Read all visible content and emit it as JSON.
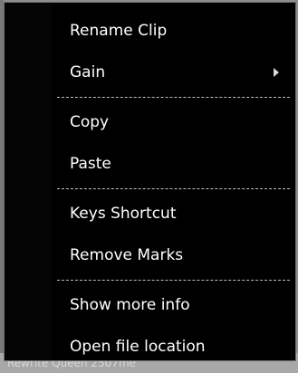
{
  "background": {
    "footer_text": "Rewrite Queen 2507me"
  },
  "menu": {
    "items": [
      {
        "label": "Rename Clip"
      },
      {
        "label": "Gain",
        "has_submenu": true,
        "submenu_icon": "triangle-right-icon"
      },
      {
        "separator": true
      },
      {
        "label": "Copy"
      },
      {
        "label": "Paste"
      },
      {
        "separator": true
      },
      {
        "label": "Keys Shortcut"
      },
      {
        "label": "Remove Marks"
      },
      {
        "separator": true
      },
      {
        "label": "Show more info"
      },
      {
        "label": "Open file location"
      }
    ]
  },
  "colors": {
    "menu_background": "#000000",
    "text": "#ffffff",
    "separator": "#bfbfbf"
  }
}
